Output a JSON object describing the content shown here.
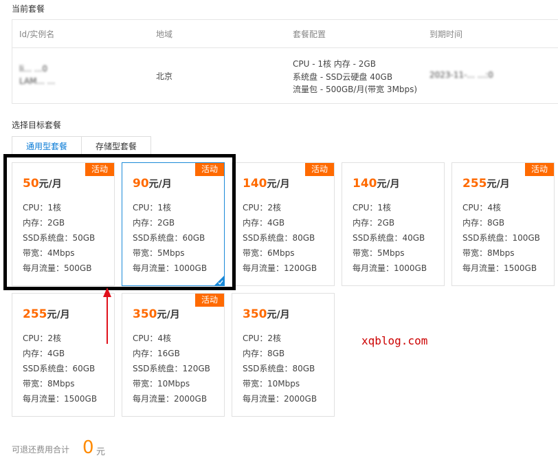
{
  "current": {
    "title": "当前套餐",
    "headers": [
      "Id/实例名",
      "地域",
      "套餐配置",
      "到期时间"
    ],
    "row": {
      "id_line1": "li...          ...0",
      "id_line2": "LAM...  ...",
      "region": "北京",
      "config": [
        "CPU - 1核 内存 - 2GB",
        "系统盘 - SSD云硬盘 40GB",
        "流量包 - 500GB/月(带宽 3Mbps)"
      ],
      "expire": "2023-11-...  ...:0"
    }
  },
  "target": {
    "title": "选择目标套餐",
    "tabs": [
      "通用型套餐",
      "存储型套餐"
    ]
  },
  "badge_label": "活动",
  "price_unit": "元/月",
  "cards": [
    {
      "price": "50",
      "badge": true,
      "cpu": "CPU：1核",
      "mem": "内存：2GB",
      "ssd": "SSD系统盘：50GB",
      "bw": "带宽：4Mbps",
      "traffic": "每月流量：500GB"
    },
    {
      "price": "90",
      "badge": true,
      "cpu": "CPU：1核",
      "mem": "内存：2GB",
      "ssd": "SSD系统盘：60GB",
      "bw": "带宽：5Mbps",
      "traffic": "每月流量：1000GB"
    },
    {
      "price": "140",
      "badge": true,
      "cpu": "CPU：2核",
      "mem": "内存：4GB",
      "ssd": "SSD系统盘：80GB",
      "bw": "带宽：6Mbps",
      "traffic": "每月流量：1200GB"
    },
    {
      "price": "140",
      "badge": false,
      "cpu": "CPU：1核",
      "mem": "内存：2GB",
      "ssd": "SSD系统盘：40GB",
      "bw": "带宽：5Mbps",
      "traffic": "每月流量：1000GB"
    },
    {
      "price": "255",
      "badge": true,
      "cpu": "CPU：4核",
      "mem": "内存：8GB",
      "ssd": "SSD系统盘：100GB",
      "bw": "带宽：8Mbps",
      "traffic": "每月流量：1500GB"
    },
    {
      "price": "255",
      "badge": false,
      "cpu": "CPU：2核",
      "mem": "内存：4GB",
      "ssd": "SSD系统盘：60GB",
      "bw": "带宽：8Mbps",
      "traffic": "每月流量：1500GB"
    },
    {
      "price": "350",
      "badge": true,
      "cpu": "CPU：4核",
      "mem": "内存：16GB",
      "ssd": "SSD系统盘：120GB",
      "bw": "带宽：10Mbps",
      "traffic": "每月流量：2000GB"
    },
    {
      "price": "350",
      "badge": false,
      "cpu": "CPU：2核",
      "mem": "内存：8GB",
      "ssd": "SSD系统盘：80GB",
      "bw": "带宽：10Mbps",
      "traffic": "每月流量：2000GB"
    }
  ],
  "watermark": "xqblog.com",
  "refund": {
    "label": "可退还费用合计",
    "amount": "0",
    "unit": "元"
  },
  "colors": {
    "accent": "#ff6a00",
    "selected_border": "#1a89d8",
    "tab_active": "#0a7bd6",
    "annotation_arrow": "#e0101a"
  }
}
